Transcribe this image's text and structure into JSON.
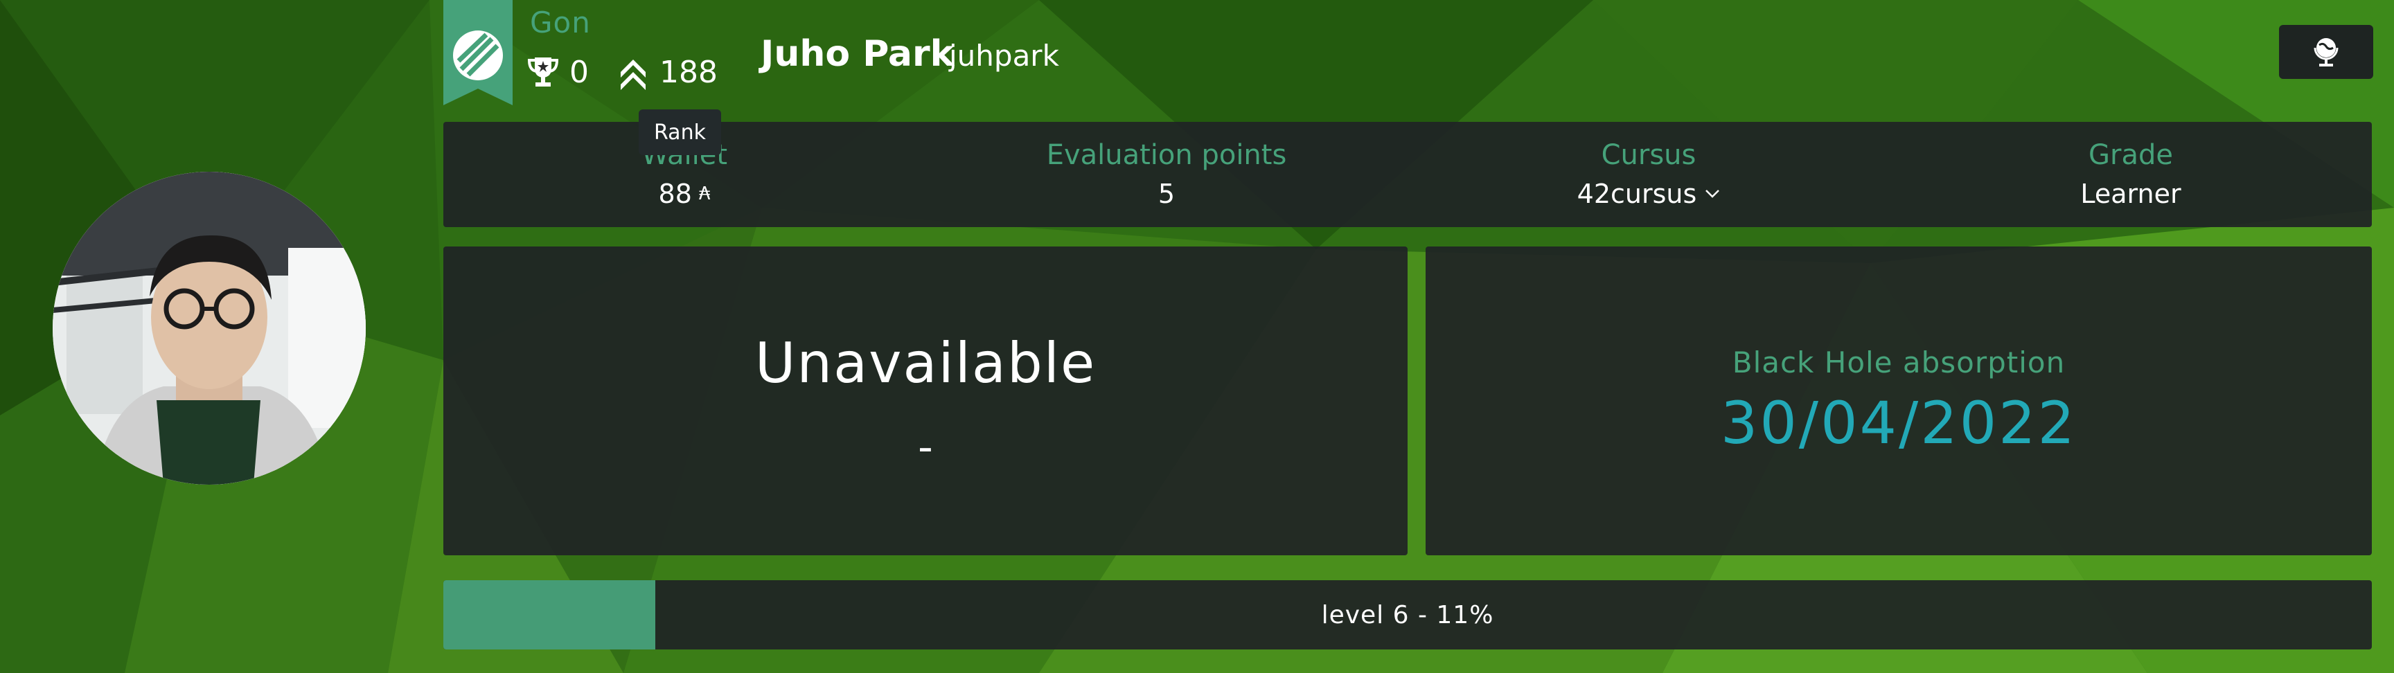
{
  "coalition": {
    "name": "Gon",
    "icon": "coalition-badge-icon",
    "color": "#46a27a"
  },
  "stats": {
    "trophies": "0",
    "rank": "188",
    "tooltip": "Rank"
  },
  "user": {
    "display_name": "Juho Park",
    "login": "juhpark"
  },
  "header": {
    "globe_icon": "globe-icon"
  },
  "info": {
    "wallet_label": "Wallet",
    "wallet_value": "88",
    "wallet_unit": "₳",
    "eval_label": "Evaluation points",
    "eval_value": "5",
    "cursus_label": "Cursus",
    "cursus_value": "42cursus",
    "grade_label": "Grade",
    "grade_value": "Learner"
  },
  "left_panel": {
    "status": "Unavailable",
    "detail": "-"
  },
  "right_panel": {
    "label": "Black Hole absorption",
    "date": "30/04/2022"
  },
  "level": {
    "text": "level 6 - 11%",
    "progress": 0.11
  },
  "colors": {
    "accent": "#46a27a",
    "blackhole_date": "#22a9b7",
    "panel": "#202325"
  }
}
